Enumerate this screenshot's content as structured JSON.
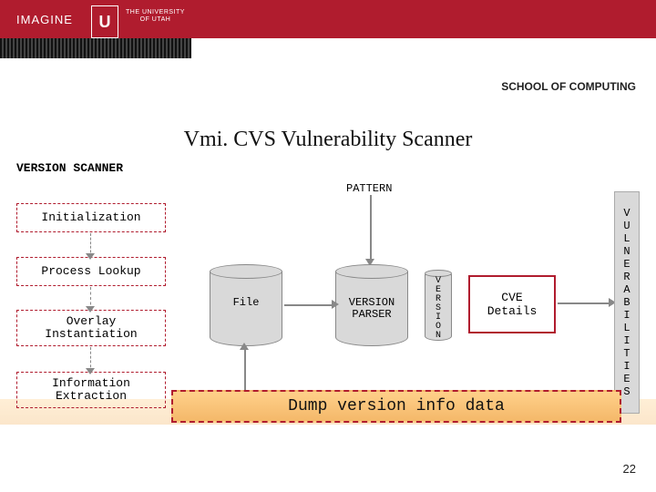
{
  "header": {
    "imagine": "IMAGINE",
    "u_letter": "U",
    "uni_top": "THE UNIVERSITY",
    "uni_bottom": "OF UTAH",
    "dept": "SCHOOL OF COMPUTING"
  },
  "title": "Vmi. CVS Vulnerability Scanner",
  "section": "VERSION SCANNER",
  "pattern": "PATTERN",
  "steps": {
    "s1": "Initialization",
    "s2": "Process Lookup",
    "s3": "Overlay\nInstantiation",
    "s4": "Information\nExtraction"
  },
  "cylinders": {
    "file": "File",
    "parser": "VERSION\nPARSER",
    "version": "V\nE\nR\nS\nI\nO\nN"
  },
  "cve": "CVE\nDetails",
  "vulnerabilities": "V\nU\nL\nN\nE\nR\nA\nB\nI\nL\nI\nT\nI\nE\nS",
  "banner": "Dump version info data",
  "pagenum": "22"
}
